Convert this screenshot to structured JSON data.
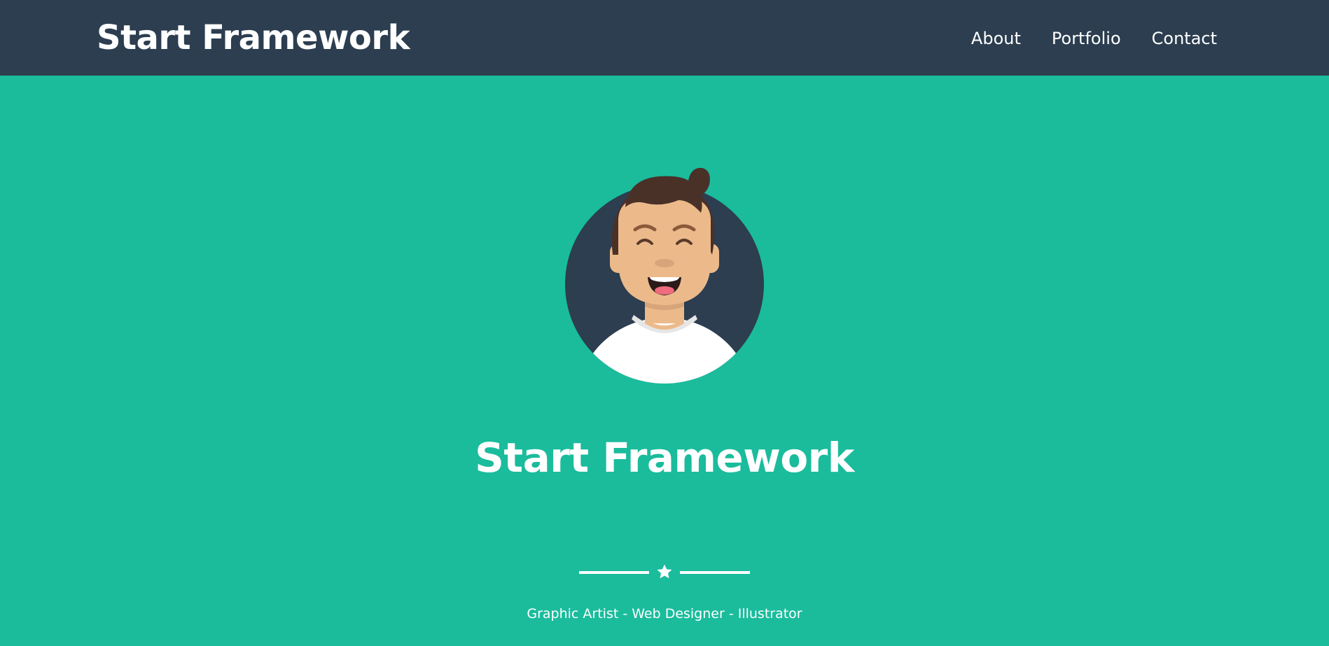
{
  "navbar": {
    "brand": "Start Framework",
    "links": [
      {
        "label": "About"
      },
      {
        "label": "Portfolio"
      },
      {
        "label": "Contact"
      }
    ]
  },
  "hero": {
    "avatar_icon": "avatar-smiling-man-icon",
    "title": "Start Framework",
    "divider_icon": "star-icon",
    "tagline": "Graphic Artist - Web Designer - Illustrator"
  },
  "colors": {
    "navbar_bg": "#2c3e50",
    "hero_bg": "#1abc9c",
    "text": "#ffffff"
  }
}
